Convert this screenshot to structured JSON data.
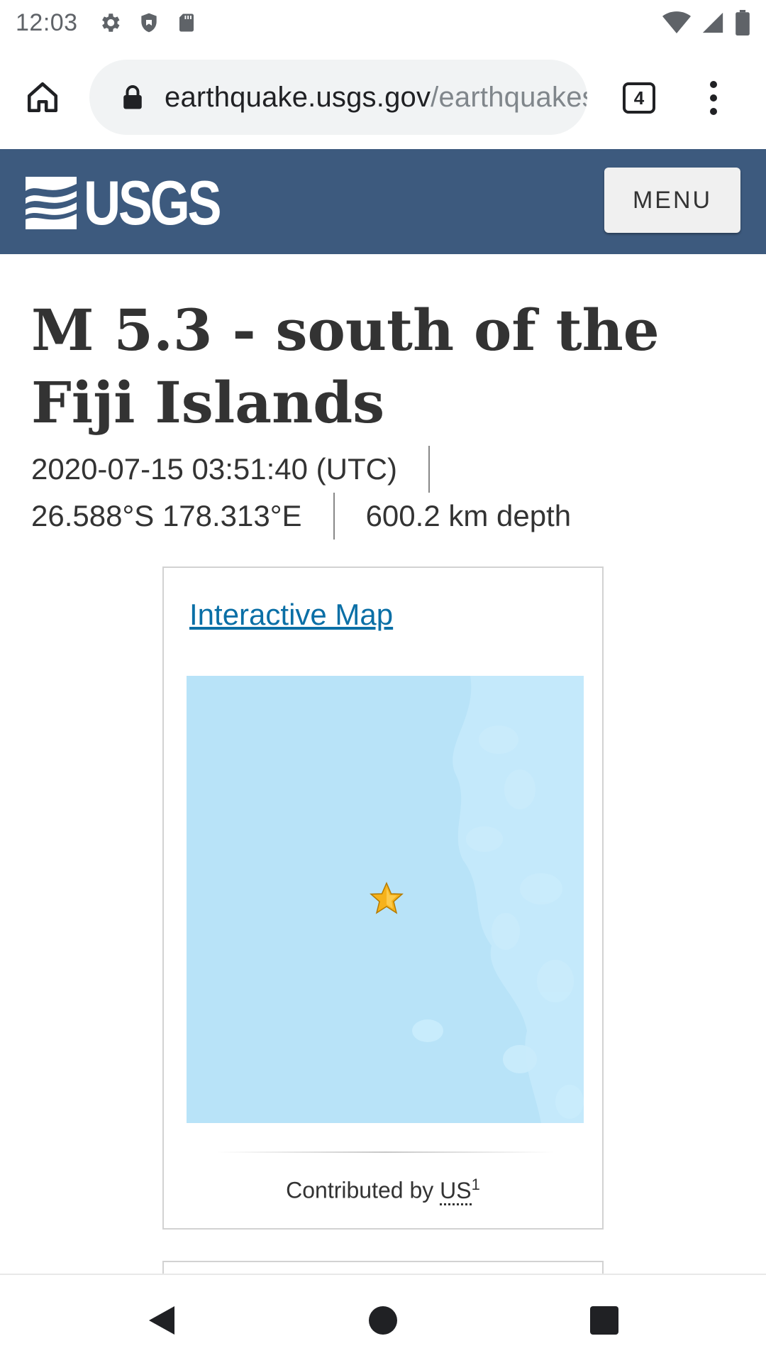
{
  "status_bar": {
    "time": "12:03",
    "left_icons": [
      "settings-icon",
      "shield-icon",
      "sd-card-icon"
    ],
    "right_icons": [
      "wifi-icon",
      "signal-icon",
      "battery-icon"
    ]
  },
  "browser": {
    "url_domain": "earthquake.usgs.gov",
    "url_path": "/earthquakes/eventpage",
    "tab_count": "4"
  },
  "site_header": {
    "logo_text": "USGS",
    "menu_label": "MENU",
    "background_color": "#3d5a7e"
  },
  "event": {
    "title": "M 5.3 - south of the Fiji Islands",
    "datetime": "2020-07-15 03:51:40 (UTC)",
    "location": "26.588°S 178.313°E",
    "depth": "600.2 km depth"
  },
  "map_card": {
    "link_label": "Interactive Map",
    "contributed_prefix": "Contributed by",
    "contributor": "US",
    "footnote": "1",
    "map_color": "#b8e3f8",
    "marker_icon": "star-icon"
  },
  "nav_bar": {
    "buttons": [
      "back-icon",
      "home-icon",
      "recents-icon"
    ]
  }
}
